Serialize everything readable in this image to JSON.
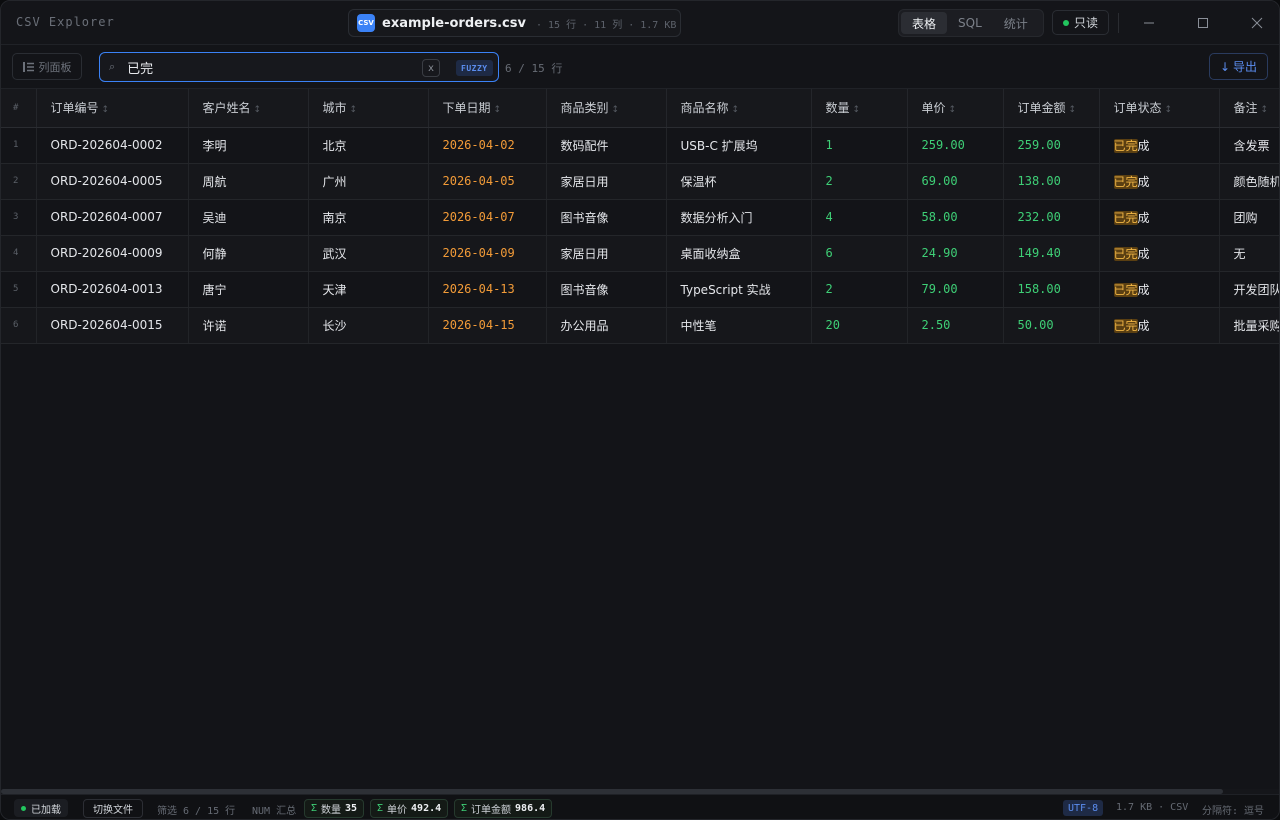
{
  "titlebar": {
    "app_title": "CSV Explorer",
    "file_icon_text": "CSV",
    "file_name": "example-orders.csv",
    "file_meta": "· 15 行 · 11 列 · 1.7 KB",
    "tabs": [
      {
        "label": "表格",
        "active": true
      },
      {
        "label": "SQL",
        "active": false
      },
      {
        "label": "统计",
        "active": false
      }
    ],
    "readonly_label": "只读"
  },
  "toolbar": {
    "panel_button_label": "列面板",
    "search_value": "已完",
    "clear_label": "x",
    "fuzzy_label": "FUZZY",
    "match_count": "6 / 15 行",
    "export_label": "导出"
  },
  "table": {
    "index_header": "#",
    "headers": [
      "订单编号",
      "客户姓名",
      "城市",
      "下单日期",
      "商品类别",
      "商品名称",
      "数量",
      "单价",
      "订单金额",
      "订单状态",
      "备注"
    ],
    "highlight": "已完",
    "rows": [
      {
        "idx": "1",
        "id": "ORD-202604-0002",
        "name": "李明",
        "city": "北京",
        "date": "2026-04-02",
        "category": "数码配件",
        "product": "USB-C 扩展坞",
        "qty": "1",
        "price": "259.00",
        "amount": "259.00",
        "status_hl": "已完",
        "status_rest": "成",
        "note": "含发票"
      },
      {
        "idx": "2",
        "id": "ORD-202604-0005",
        "name": "周航",
        "city": "广州",
        "date": "2026-04-05",
        "category": "家居日用",
        "product": "保温杯",
        "qty": "2",
        "price": "69.00",
        "amount": "138.00",
        "status_hl": "已完",
        "status_rest": "成",
        "note": "颜色随机"
      },
      {
        "idx": "3",
        "id": "ORD-202604-0007",
        "name": "吴迪",
        "city": "南京",
        "date": "2026-04-07",
        "category": "图书音像",
        "product": "数据分析入门",
        "qty": "4",
        "price": "58.00",
        "amount": "232.00",
        "status_hl": "已完",
        "status_rest": "成",
        "note": "团购"
      },
      {
        "idx": "4",
        "id": "ORD-202604-0009",
        "name": "何静",
        "city": "武汉",
        "date": "2026-04-09",
        "category": "家居日用",
        "product": "桌面收纳盒",
        "qty": "6",
        "price": "24.90",
        "amount": "149.40",
        "status_hl": "已完",
        "status_rest": "成",
        "note": "无"
      },
      {
        "idx": "5",
        "id": "ORD-202604-0013",
        "name": "唐宁",
        "city": "天津",
        "date": "2026-04-13",
        "category": "图书音像",
        "product": "TypeScript 实战",
        "qty": "2",
        "price": "79.00",
        "amount": "158.00",
        "status_hl": "已完",
        "status_rest": "成",
        "note": "开发团队"
      },
      {
        "idx": "6",
        "id": "ORD-202604-0015",
        "name": "许诺",
        "city": "长沙",
        "date": "2026-04-15",
        "category": "办公用品",
        "product": "中性笔",
        "qty": "20",
        "price": "2.50",
        "amount": "50.00",
        "status_hl": "已完",
        "status_rest": "成",
        "note": "批量采购"
      }
    ]
  },
  "statusbar": {
    "loaded_label": "已加载",
    "switch_label": "切换文件",
    "filter_text": "筛选 6 / 15 行",
    "num_label": "NUM 汇总",
    "sums": [
      {
        "sigma": "Σ",
        "label": "数量",
        "value": "35"
      },
      {
        "sigma": "Σ",
        "label": "单价",
        "value": "492.4"
      },
      {
        "sigma": "Σ",
        "label": "订单金额",
        "value": "986.4"
      }
    ],
    "encoding": "UTF-8",
    "size_type": "1.7 KB · CSV",
    "delimiter": "分隔符: 逗号"
  },
  "colors": {
    "accent": "#3b82f6",
    "date": "#f29b38",
    "number": "#3ecf76",
    "highlight_bg": "#5a3f12"
  }
}
